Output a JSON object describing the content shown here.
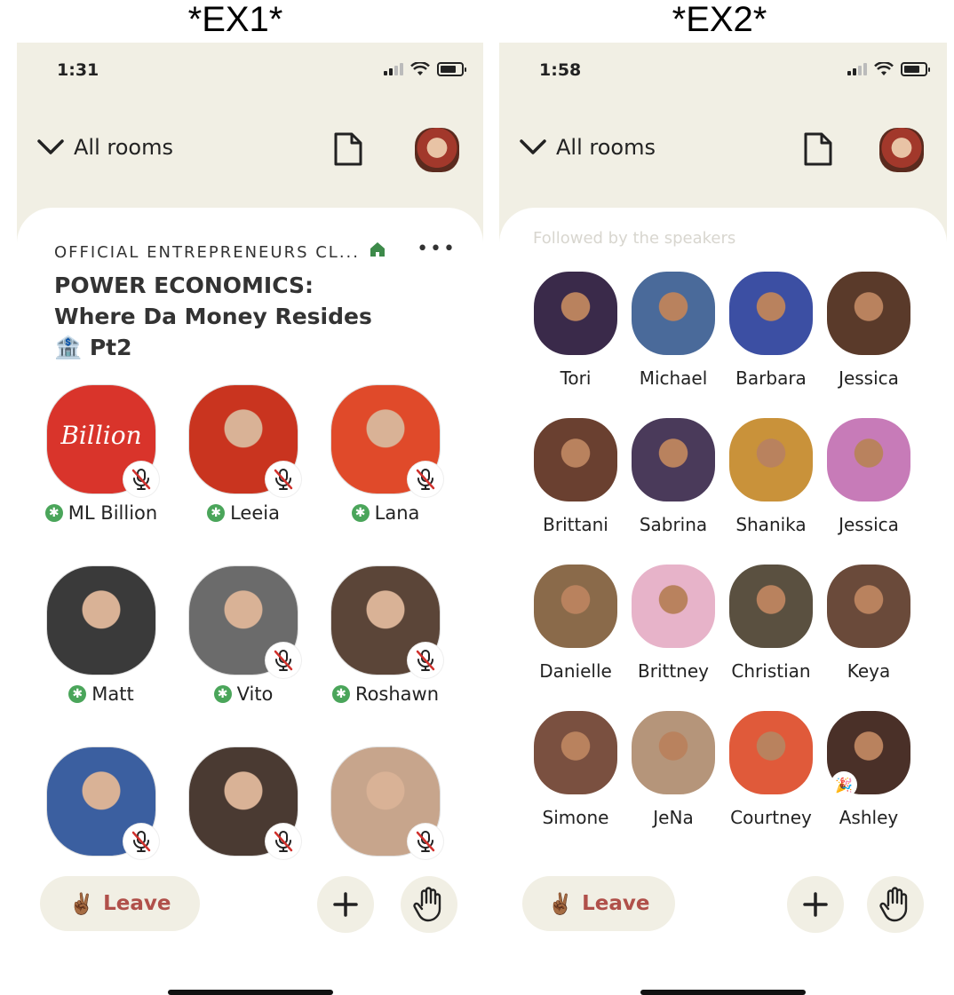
{
  "labels": {
    "left": "*EX1*",
    "right": "*EX2*"
  },
  "ex1": {
    "status": {
      "time": "1:31"
    },
    "nav": {
      "all_rooms": "All rooms"
    },
    "club": {
      "name": "OFFICIAL ENTREPRENEURS CL...",
      "more": "•••"
    },
    "room": {
      "title_line1": "POWER ECONOMICS:",
      "title_line2": "Where Da Money Resides",
      "title_line3": "Pt2",
      "title_emoji": "🏦"
    },
    "speakers": [
      {
        "name": "ML Billion",
        "moderator": true,
        "muted": true,
        "avatar_text": "Billion",
        "color": "#d9342b"
      },
      {
        "name": "Leeia",
        "moderator": true,
        "muted": true,
        "color": "#c9341f"
      },
      {
        "name": "Lana",
        "moderator": true,
        "muted": true,
        "color": "#e04a2a"
      },
      {
        "name": "Matt",
        "moderator": true,
        "muted": false,
        "color": "#3a3a3a"
      },
      {
        "name": "Vito",
        "moderator": true,
        "muted": true,
        "color": "#6b6b6b"
      },
      {
        "name": "Roshawn",
        "moderator": true,
        "muted": true,
        "color": "#5b4538"
      },
      {
        "name": "",
        "moderator": false,
        "muted": true,
        "color": "#3b5fa0"
      },
      {
        "name": "",
        "moderator": false,
        "muted": true,
        "color": "#4a3a32"
      },
      {
        "name": "",
        "moderator": false,
        "muted": true,
        "color": "#c7a58c"
      }
    ],
    "bottom": {
      "leave": "Leave",
      "leave_emoji": "✌🏾"
    }
  },
  "ex2": {
    "status": {
      "time": "1:58"
    },
    "nav": {
      "all_rooms": "All rooms"
    },
    "followed_title": "Followed by the speakers",
    "people": [
      {
        "name": "Tori",
        "color": "#3a2a4a"
      },
      {
        "name": "Michael",
        "color": "#4a6a9a"
      },
      {
        "name": "Barbara",
        "color": "#3c4fa3"
      },
      {
        "name": "Jessica",
        "color": "#5a3a2a"
      },
      {
        "name": "Brittani",
        "color": "#6a4030"
      },
      {
        "name": "Sabrina",
        "color": "#4a3a5a"
      },
      {
        "name": "Shanika",
        "color": "#c9923a"
      },
      {
        "name": "Jessica",
        "color": "#c77bb8"
      },
      {
        "name": "Danielle",
        "color": "#8a6a4a"
      },
      {
        "name": "Brittney",
        "color": "#e7b3c9"
      },
      {
        "name": "Christian",
        "color": "#5a5040"
      },
      {
        "name": "Keya",
        "color": "#6a4a3a"
      },
      {
        "name": "Simone",
        "color": "#7a5040"
      },
      {
        "name": "JeNa",
        "color": "#b5957a"
      },
      {
        "name": "Courtney",
        "color": "#e05a3a"
      },
      {
        "name": "Ashley",
        "color": "#4a3028",
        "party": true
      }
    ],
    "bottom": {
      "leave": "Leave",
      "leave_emoji": "✌🏾"
    }
  }
}
